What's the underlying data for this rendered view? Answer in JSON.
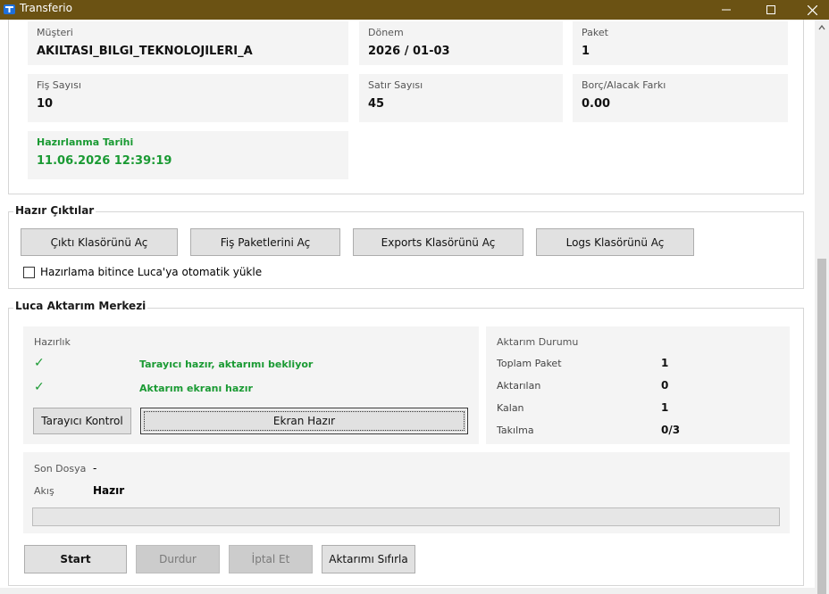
{
  "window": {
    "title": "Transferio",
    "minimize_glyph": "—",
    "maximize_glyph": "☐",
    "close_glyph": "✕"
  },
  "info": {
    "musteri": {
      "label": "Müşteri",
      "value": "AKILTASI_BILGI_TEKNOLOJILERI_A"
    },
    "donem": {
      "label": "Dönem",
      "value": "2026 / 01-03"
    },
    "paket": {
      "label": "Paket",
      "value": "1"
    },
    "fis_sayisi": {
      "label": "Fiş Sayısı",
      "value": "10"
    },
    "satir_sayisi": {
      "label": "Satır Sayısı",
      "value": "45"
    },
    "borc_alacak": {
      "label": "Borç/Alacak Farkı",
      "value": "0.00"
    },
    "hazirlanma": {
      "label": "Hazırlanma Tarihi",
      "value": "11.06.2026 12:39:19"
    }
  },
  "outputs": {
    "title": "Hazır Çıktılar",
    "buttons": {
      "cikti": "Çıktı Klasörünü Aç",
      "fis": "Fiş Paketlerini Aç",
      "exports": "Exports Klasörünü Aç",
      "logs": "Logs Klasörünü Aç"
    },
    "auto_upload": {
      "label": "Hazırlama bitince Luca'ya otomatik yükle",
      "checked": false
    }
  },
  "luca": {
    "title": "Luca Aktarım Merkezi",
    "hazirlik": {
      "title": "Hazırlık",
      "check_glyph": "✓",
      "items": [
        {
          "status": "Tarayıcı hazır, aktarımı bekliyor"
        },
        {
          "status": "Aktarım ekranı hazır"
        }
      ],
      "tarayici_button": "Tarayıcı Kontrol",
      "ekran_button": "Ekran Hazır"
    },
    "durum": {
      "title": "Aktarım Durumu",
      "rows": [
        {
          "label": "Toplam Paket",
          "value": "1"
        },
        {
          "label": "Aktarılan",
          "value": "0"
        },
        {
          "label": "Kalan",
          "value": "1"
        },
        {
          "label": "Takılma",
          "value": "0/3"
        }
      ]
    },
    "son_dosya": {
      "label": "Son Dosya",
      "value": "-"
    },
    "akis": {
      "label": "Akış",
      "value": "Hazır"
    },
    "progress": 0,
    "actions": {
      "start": "Start",
      "durdur": "Durdur",
      "iptal": "İptal Et",
      "sifirla": "Aktarımı Sıfırla"
    }
  },
  "colors": {
    "titlebar": "#6b5213",
    "success": "#1a9a33",
    "panel": "#f4f4f4"
  }
}
